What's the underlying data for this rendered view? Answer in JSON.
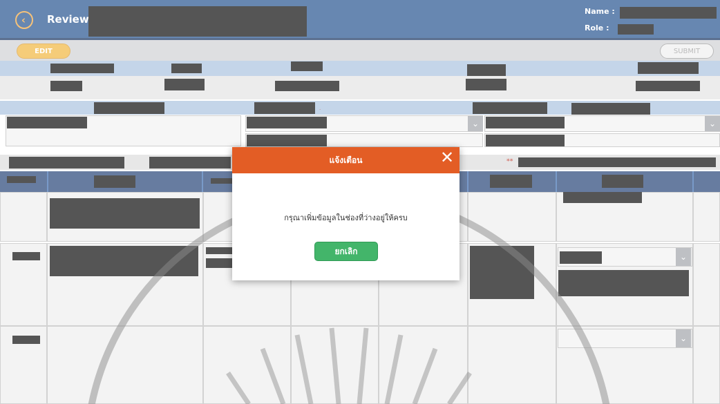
{
  "header": {
    "title": "Review",
    "name_label": "Name :",
    "role_label": "Role :"
  },
  "toolbar": {
    "edit_label": "EDIT",
    "submit_label": "SUBMIT"
  },
  "form": {
    "star_marker": "**"
  },
  "dialog": {
    "title": "แจ้งเตือน",
    "message": "กรุณาเพิ่มข้อมูลในช่องที่ว่างอยู่ให้ครบ",
    "cancel_label": "ยกเลิก"
  },
  "icons": {
    "back": "back-arrow-icon",
    "close": "close-icon",
    "dropdown": "chevron-down-icon"
  },
  "colors": {
    "header_bg": "#1f4e8c",
    "accent_orange": "#e35d25",
    "edit_yellow": "#f0b43a",
    "confirm_green": "#43b56a"
  }
}
